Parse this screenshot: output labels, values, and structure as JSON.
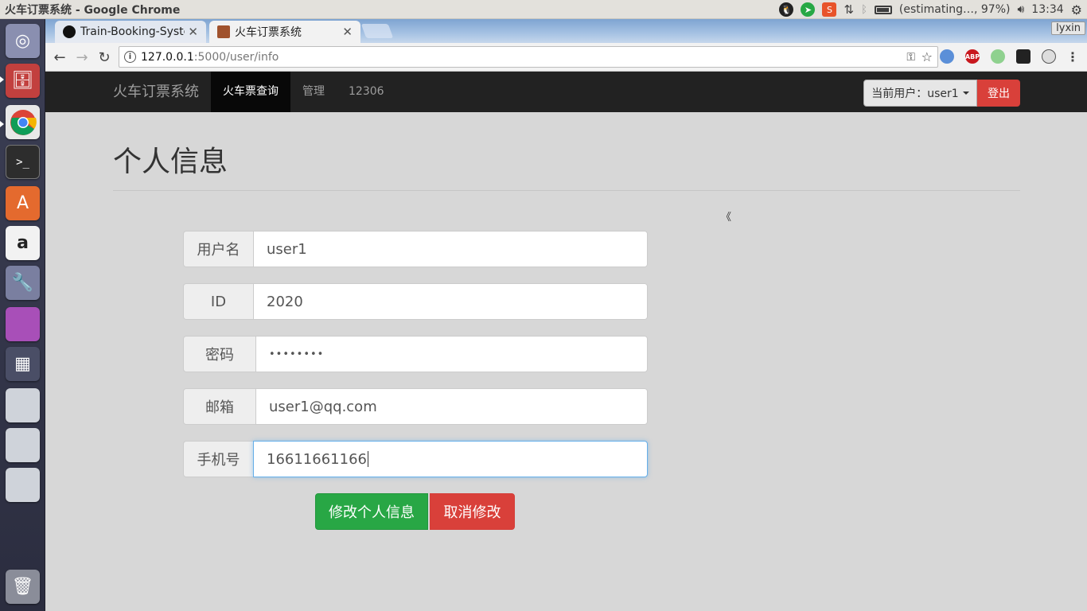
{
  "os": {
    "window_title": "火车订票系统 - Google Chrome",
    "battery_text": "(estimating…, 97%)",
    "clock": "13:34"
  },
  "browser": {
    "tabs": [
      {
        "title": "Train-Booking-Syste",
        "active": false
      },
      {
        "title": "火车订票系统",
        "active": true
      }
    ],
    "profile_name": "lyxin",
    "url_host": "127.0.0.1",
    "url_path": ":5000/user/info",
    "ext_abp": "ABP"
  },
  "navbar": {
    "brand": "火车订票系统",
    "links": [
      "火车票查询",
      "管理",
      "12306"
    ],
    "current_user_label": "当前用户：user1",
    "logout_label": "登出"
  },
  "page": {
    "title": "个人信息",
    "collapse_glyph": "《"
  },
  "form": {
    "fields": [
      {
        "label": "用户名",
        "value": "user1"
      },
      {
        "label": "ID",
        "value": "2020"
      },
      {
        "label": "密码",
        "value": "••••••••"
      },
      {
        "label": "邮箱",
        "value": "user1@qq.com"
      },
      {
        "label": "手机号",
        "value": "16611661166"
      }
    ],
    "submit_label": "修改个人信息",
    "cancel_label": "取消修改"
  },
  "colors": {
    "navbar_bg": "#222222",
    "success": "#28a745",
    "danger": "#d9403a",
    "page_bg": "#d7d7d7"
  }
}
